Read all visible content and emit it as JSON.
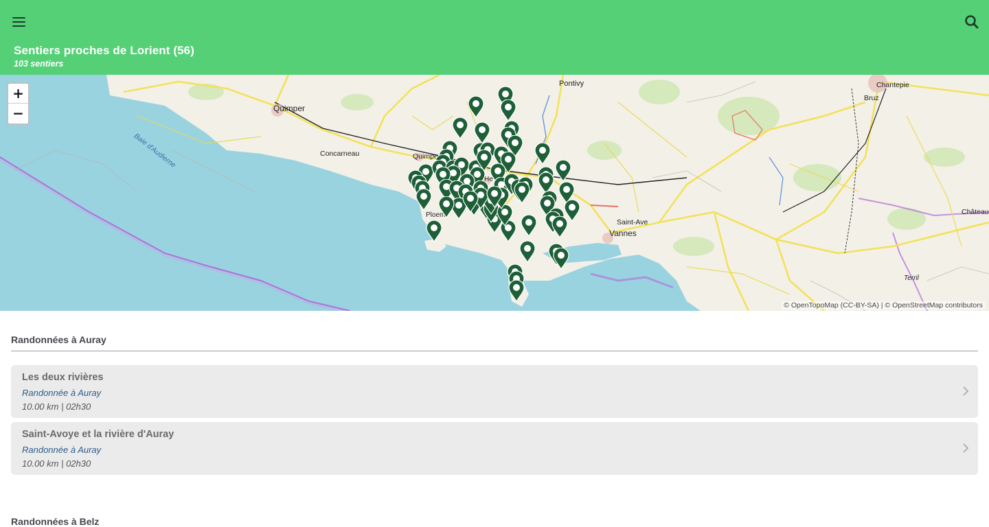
{
  "header": {
    "title": "Sentiers proches de Lorient (56)",
    "subtitle": "103 sentiers"
  },
  "map": {
    "zoom_in": "+",
    "zoom_out": "−",
    "attribution": "© OpenTopoMap (CC-BY-SA) | © OpenStreetMap contributors",
    "labels": [
      "Quimper",
      "Pontivy",
      "Concarneau",
      "Quimperlé",
      "Baie d'Audierne",
      "Chantepie",
      "Bruz",
      "Saint-Ave",
      "Vannes",
      "Châteaubr",
      "Terril",
      "Ploem",
      "He"
    ],
    "colors": {
      "sea": "#9ad3e0",
      "land": "#f2efe6",
      "marker": "#1e5f37",
      "road": "#f2e25a"
    }
  },
  "sections": [
    {
      "title": "Randonnées à Auray",
      "items": [
        {
          "title": "Les deux rivières",
          "subtitle": "Randonnée à Auray",
          "meta": "10.00 km | 02h30"
        },
        {
          "title": "Saint-Avoye et la rivière d'Auray",
          "subtitle": "Randonnée à Auray",
          "meta": "10.00 km | 02h30"
        }
      ]
    },
    {
      "title": "Randonnées à Belz",
      "items": []
    }
  ],
  "icons": {
    "menu": "hamburger-icon",
    "search": "search-icon",
    "chevron": "chevron-right-icon",
    "marker": "map-pin-icon"
  },
  "colors": {
    "appbar": "#55d077",
    "card": "#ebebeb",
    "subtitle_link": "#2b5c8a"
  }
}
